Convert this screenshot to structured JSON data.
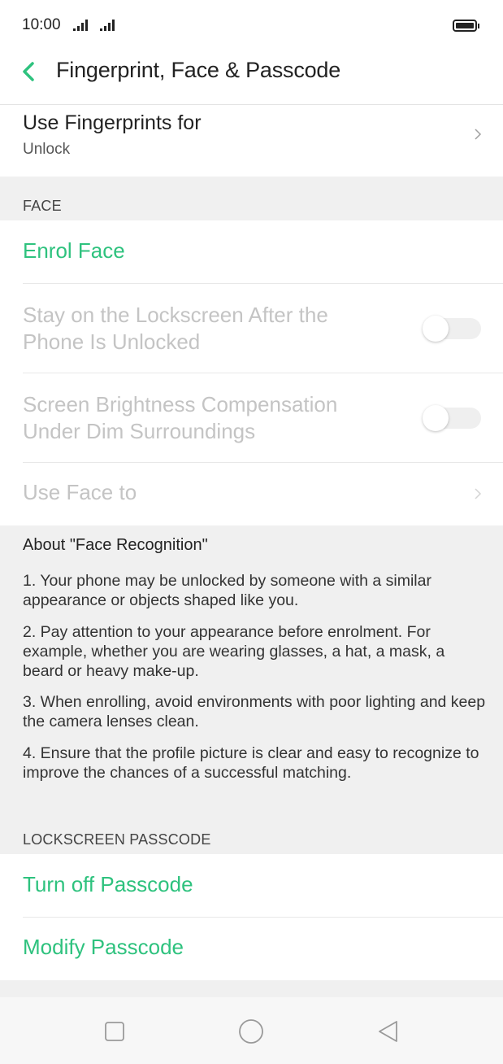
{
  "status_bar": {
    "time": "10:00"
  },
  "header": {
    "title": "Fingerprint, Face & Passcode"
  },
  "fingerprint": {
    "title": "Use Fingerprints for",
    "subtitle": "Unlock"
  },
  "face": {
    "section_label": "FACE",
    "enrol_label": "Enrol Face",
    "stay_on_lockscreen": {
      "line1": "Stay on the Lockscreen After the",
      "line2": "Phone Is Unlocked",
      "enabled": false
    },
    "brightness_compensation": {
      "line1": "Screen Brightness Compensation",
      "line2": "Under Dim Surroundings",
      "enabled": false
    },
    "use_face_to": "Use Face to"
  },
  "about": {
    "title": "About \"Face Recognition\"",
    "items": [
      "1. Your phone may be unlocked by someone with a similar appearance or objects shaped like you.",
      "2. Pay attention to your appearance before enrolment. For example, whether you are wearing glasses, a hat, a mask, a beard or heavy make-up.",
      "3. When enrolling, avoid environments with poor lighting and keep the camera lenses clean.",
      "4. Ensure that the profile picture is clear and easy to recognize to improve the chances of a successful matching."
    ]
  },
  "passcode": {
    "section_label": "LOCKSCREEN PASSCODE",
    "turn_off": "Turn off Passcode",
    "modify": "Modify Passcode"
  },
  "colors": {
    "accent": "#2ec27e",
    "disabled_text": "#c4c4c4",
    "background": "#f0f0f0"
  },
  "icons": [
    "back-icon",
    "chevron-right-icon",
    "square-nav-icon",
    "circle-nav-icon",
    "triangle-nav-icon",
    "battery-icon",
    "signal-icon"
  ]
}
